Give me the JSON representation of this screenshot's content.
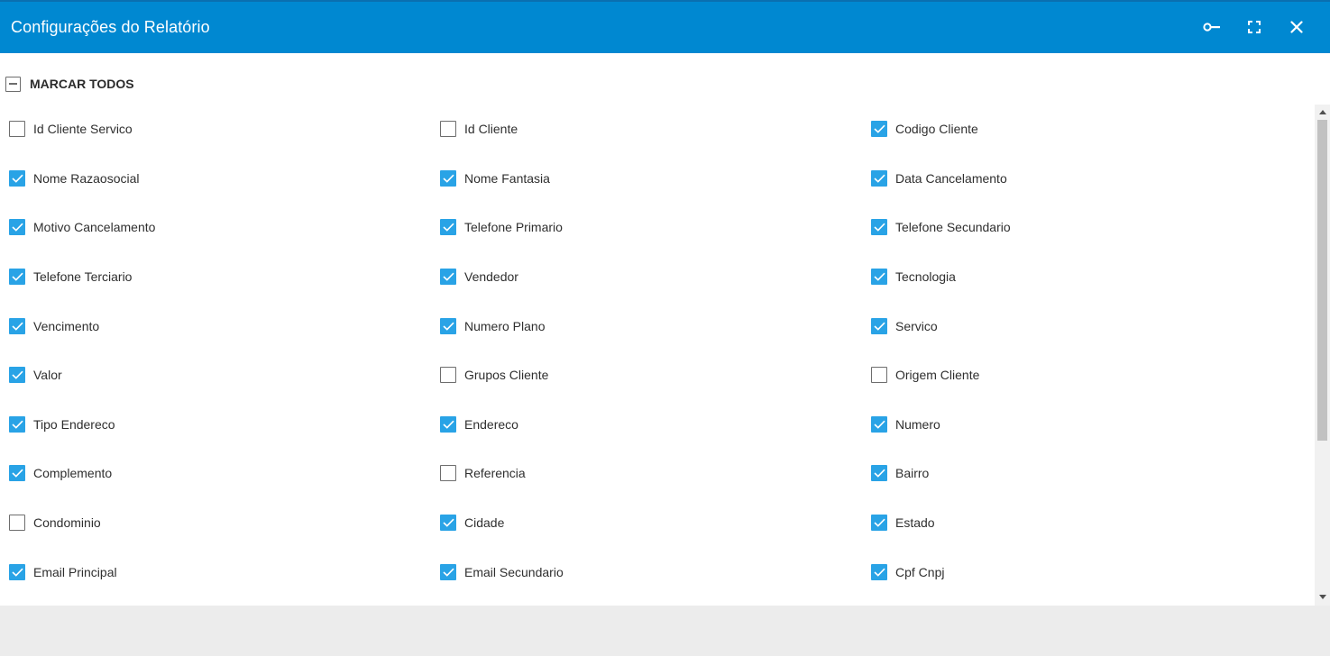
{
  "header": {
    "title": "Configurações do Relatório",
    "background": "#0088d1",
    "icons": [
      "key-icon",
      "fullscreen-icon",
      "close-icon"
    ]
  },
  "select_all": {
    "label": "MARCAR TODOS",
    "state": "indeterminate"
  },
  "checkbox_color": "#29a3e6",
  "rows": [
    [
      {
        "label": "Id Cliente Servico",
        "checked": false
      },
      {
        "label": "Id Cliente",
        "checked": false
      },
      {
        "label": "Codigo Cliente",
        "checked": true
      }
    ],
    [
      {
        "label": "Nome Razaosocial",
        "checked": true
      },
      {
        "label": "Nome Fantasia",
        "checked": true
      },
      {
        "label": "Data Cancelamento",
        "checked": true
      }
    ],
    [
      {
        "label": "Motivo Cancelamento",
        "checked": true
      },
      {
        "label": "Telefone Primario",
        "checked": true
      },
      {
        "label": "Telefone Secundario",
        "checked": true
      }
    ],
    [
      {
        "label": "Telefone Terciario",
        "checked": true
      },
      {
        "label": "Vendedor",
        "checked": true
      },
      {
        "label": "Tecnologia",
        "checked": true
      }
    ],
    [
      {
        "label": "Vencimento",
        "checked": true
      },
      {
        "label": "Numero Plano",
        "checked": true
      },
      {
        "label": "Servico",
        "checked": true
      }
    ],
    [
      {
        "label": "Valor",
        "checked": true
      },
      {
        "label": "Grupos Cliente",
        "checked": false
      },
      {
        "label": "Origem Cliente",
        "checked": false
      }
    ],
    [
      {
        "label": "Tipo Endereco",
        "checked": true
      },
      {
        "label": "Endereco",
        "checked": true
      },
      {
        "label": "Numero",
        "checked": true
      }
    ],
    [
      {
        "label": "Complemento",
        "checked": true
      },
      {
        "label": "Referencia",
        "checked": false
      },
      {
        "label": "Bairro",
        "checked": true
      }
    ],
    [
      {
        "label": "Condominio",
        "checked": false
      },
      {
        "label": "Cidade",
        "checked": true
      },
      {
        "label": "Estado",
        "checked": true
      }
    ],
    [
      {
        "label": "Email Principal",
        "checked": true
      },
      {
        "label": "Email Secundario",
        "checked": true
      },
      {
        "label": "Cpf Cnpj",
        "checked": true
      }
    ]
  ]
}
